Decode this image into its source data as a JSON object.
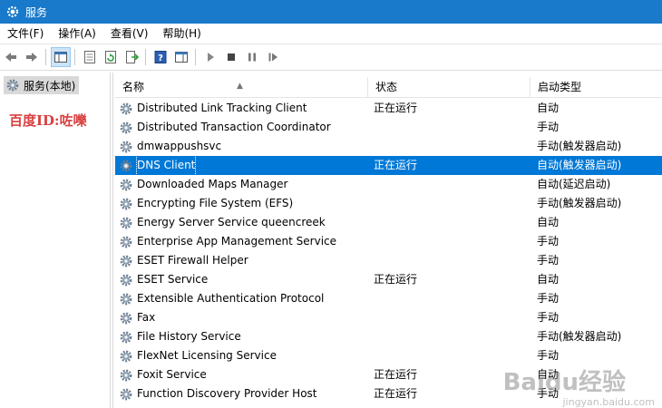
{
  "window": {
    "title": "服务"
  },
  "menu": [
    "文件(F)",
    "操作(A)",
    "查看(V)",
    "帮助(H)"
  ],
  "toolbar": {
    "icons": [
      "back-arrow-icon",
      "forward-arrow-icon",
      "console-tree-icon",
      "properties-icon",
      "refresh-icon",
      "export-list-icon",
      "help-icon",
      "show-hide-icon",
      "start-service-icon",
      "stop-service-icon",
      "pause-service-icon",
      "resume-service-icon"
    ]
  },
  "tree": {
    "root_label": "服务(本地)"
  },
  "watermark_left": "百度ID:咗嚛",
  "columns": {
    "name": "名称",
    "status": "状态",
    "startup": "启动类型"
  },
  "services": [
    {
      "name": "Distributed Link Tracking Client",
      "status": "正在运行",
      "startup": "自动"
    },
    {
      "name": "Distributed Transaction Coordinator",
      "status": "",
      "startup": "手动"
    },
    {
      "name": "dmwappushsvc",
      "status": "",
      "startup": "手动(触发器启动)"
    },
    {
      "name": "DNS Client",
      "status": "正在运行",
      "startup": "自动(触发器启动)"
    },
    {
      "name": "Downloaded Maps Manager",
      "status": "",
      "startup": "自动(延迟启动)"
    },
    {
      "name": "Encrypting File System (EFS)",
      "status": "",
      "startup": "手动(触发器启动)"
    },
    {
      "name": "Energy Server Service queencreek",
      "status": "",
      "startup": "自动"
    },
    {
      "name": "Enterprise App Management Service",
      "status": "",
      "startup": "手动"
    },
    {
      "name": "ESET Firewall Helper",
      "status": "",
      "startup": "手动"
    },
    {
      "name": "ESET Service",
      "status": "正在运行",
      "startup": "自动"
    },
    {
      "name": "Extensible Authentication Protocol",
      "status": "",
      "startup": "手动"
    },
    {
      "name": "Fax",
      "status": "",
      "startup": "手动"
    },
    {
      "name": "File History Service",
      "status": "",
      "startup": "手动(触发器启动)"
    },
    {
      "name": "FlexNet Licensing Service",
      "status": "",
      "startup": "手动"
    },
    {
      "name": "Foxit Service",
      "status": "正在运行",
      "startup": "自动"
    },
    {
      "name": "Function Discovery Provider Host",
      "status": "正在运行",
      "startup": "手动"
    }
  ],
  "selected_index": 3,
  "watermark_right": "Baidu经验",
  "watermark_right_sub": "jingyan.baidu.com",
  "colors": {
    "title_bar": "#1979ca",
    "selection": "#0078d7",
    "watermark_red": "#d94040"
  }
}
